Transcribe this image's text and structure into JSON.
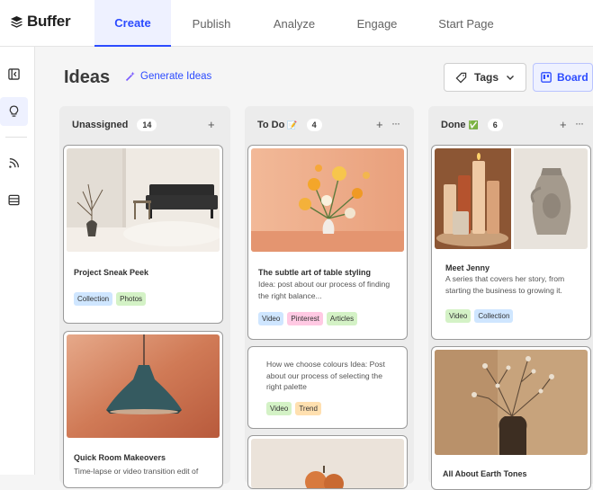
{
  "app": {
    "brand": "Buffer"
  },
  "nav": {
    "tabs": [
      {
        "label": "Create",
        "active": true
      },
      {
        "label": "Publish"
      },
      {
        "label": "Analyze"
      },
      {
        "label": "Engage"
      },
      {
        "label": "Start Page"
      }
    ]
  },
  "header": {
    "title": "Ideas",
    "generate_label": "Generate Ideas",
    "tags_label": "Tags",
    "board_label": "Board"
  },
  "columns": [
    {
      "title": "Unassigned",
      "emoji": "",
      "count": "14"
    },
    {
      "title": "To Do",
      "emoji": "📝",
      "count": "4"
    },
    {
      "title": "Done",
      "emoji": "✅",
      "count": "6"
    }
  ],
  "cards": {
    "c1": {
      "title": "Project Sneak Peek",
      "tags": [
        "Collection",
        "Photos"
      ]
    },
    "c2": {
      "title": "Quick Room Makeovers",
      "text": "Time-lapse or video transition edit of"
    },
    "c3": {
      "title": "The subtle art of table styling",
      "text": "Idea: post about our process of finding the right balance...",
      "tags": [
        "Video",
        "Pinterest",
        "Articles"
      ]
    },
    "c4": {
      "text": "How we choose colours Idea: Post about our process of selecting the right palette",
      "tags": [
        "Video",
        "Trend"
      ]
    },
    "c5": {
      "title": "Meet Jenny",
      "text": "A series that covers her story, from starting the business to growing it.",
      "tags": [
        "Video",
        "Collection"
      ]
    },
    "c6": {
      "title": "All About Earth Tones"
    }
  },
  "colors": {
    "accent": "#2c4bff",
    "tag_blue": "#cfe6ff",
    "tag_green": "#d4f2c6",
    "tag_pink": "#ffc9e3",
    "tag_orange": "#ffe0b0"
  }
}
